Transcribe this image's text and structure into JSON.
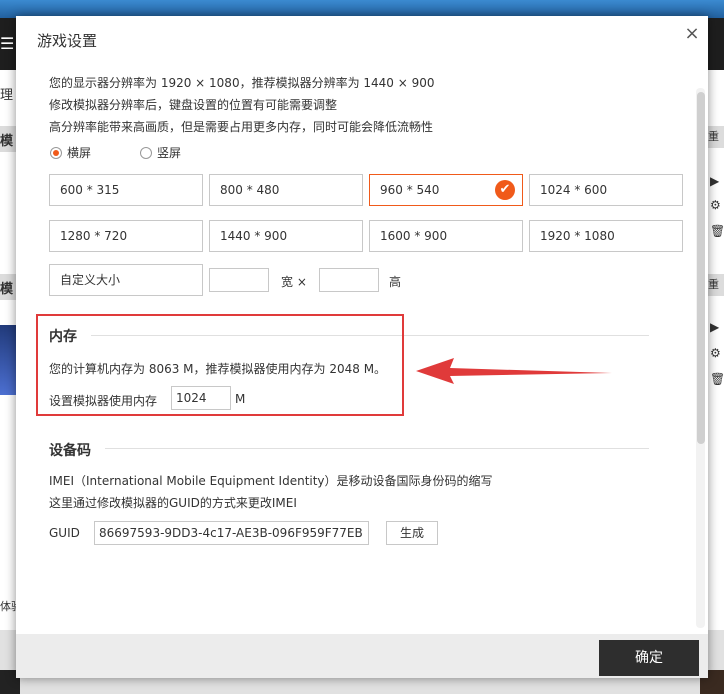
{
  "background": {
    "left_labels": [
      "理",
      "模",
      "模",
      "体验"
    ],
    "right_labels": [
      "重",
      "重"
    ]
  },
  "dialog": {
    "title": "游戏设置",
    "close": "×"
  },
  "display": {
    "line1": "您的显示器分辨率为 1920 × 1080，推荐模拟器分辨率为 1440 × 900",
    "line2": "修改模拟器分辨率后，键盘设置的位置有可能需要调整",
    "line3": "高分辨率能带来高画质，但是需要占用更多内存，同时可能会降低流畅性",
    "orientation": [
      {
        "label": "横屏",
        "selected": true
      },
      {
        "label": "竖屏",
        "selected": false
      }
    ],
    "resolutions": [
      {
        "label": "600 * 315",
        "selected": false
      },
      {
        "label": "800 * 480",
        "selected": false
      },
      {
        "label": "960 * 540",
        "selected": true
      },
      {
        "label": "1024 * 600",
        "selected": false
      },
      {
        "label": "1280 * 720",
        "selected": false
      },
      {
        "label": "1440 * 900",
        "selected": false
      },
      {
        "label": "1600 * 900",
        "selected": false
      },
      {
        "label": "1920 * 1080",
        "selected": false
      }
    ],
    "custom_label": "自定义大小",
    "width_value": "",
    "height_value": "",
    "width_unit": "宽 ×",
    "height_unit": "高"
  },
  "memory": {
    "title": "内存",
    "info": "您的计算机内存为 8063 M，推荐模拟器使用内存为 2048 M。",
    "setting_label": "设置模拟器使用内存",
    "value": "1024",
    "unit": "M"
  },
  "device": {
    "title": "设备码",
    "line1": "IMEI（International Mobile Equipment Identity）是移动设备国际身份码的缩写",
    "line2": "这里通过修改模拟器的GUID的方式来更改IMEI",
    "guid_label": "GUID",
    "guid_value": "86697593-9DD3-4c17-AE3B-096F959F77EB",
    "generate": "生成"
  },
  "footer": {
    "ok": "确定"
  },
  "colors": {
    "accent": "#f05a1a",
    "highlight": "#e03a3a"
  }
}
